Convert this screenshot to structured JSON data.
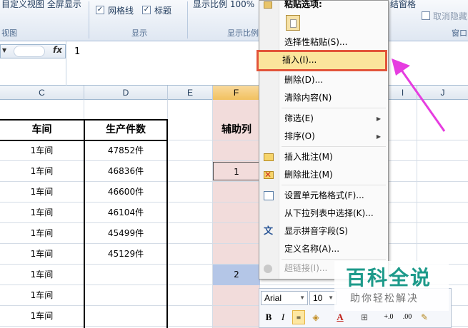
{
  "ribbon": {
    "view_buttons": "目定义视图 全屏显示",
    "checkbox_gridlines": "网格线",
    "checkbox_headings": "标题",
    "group_views": "视图",
    "group_show": "显示",
    "zoom_label": "显示比例 100%",
    "group_zoom": "显示比例",
    "freeze_panes": "结窗格",
    "unhide": "取消隐藏",
    "group_window": "窗口"
  },
  "formula_bar": {
    "fx_label": "fx",
    "value": "1"
  },
  "columns": [
    "C",
    "D",
    "E",
    "F",
    "I",
    "J"
  ],
  "table": {
    "header_workshop": "车间",
    "header_count": "生产件数",
    "helper_header": "辅助列",
    "rows": [
      {
        "workshop": "1车间",
        "count": "47852件"
      },
      {
        "workshop": "1车间",
        "count": "46836件"
      },
      {
        "workshop": "1车间",
        "count": "46600件"
      },
      {
        "workshop": "1车间",
        "count": "46104件"
      },
      {
        "workshop": "1车间",
        "count": "45499件"
      },
      {
        "workshop": "1车间",
        "count": "45129件"
      },
      {
        "workshop": "1车间",
        "count": ""
      },
      {
        "workshop": "1车间",
        "count": ""
      },
      {
        "workshop": "1车间",
        "count": ""
      }
    ],
    "helper_values": [
      "1",
      "2"
    ]
  },
  "context_menu": {
    "paste_options": "粘贴选项:",
    "paste_special": "选择性粘贴(S)...",
    "insert": "插入(I)...",
    "delete": "删除(D)...",
    "clear_contents": "清除内容(N)",
    "filter": "筛选(E)",
    "sort": "排序(O)",
    "insert_comment": "插入批注(M)",
    "delete_comment": "删除批注(M)",
    "format_cells": "设置单元格格式(F)...",
    "pick_from_list": "从下拉列表中选择(K)...",
    "show_phonetic": "显示拼音字段(S)",
    "define_name": "定义名称(A)...",
    "hyperlink": "超链接(I)..."
  },
  "mini_toolbar": {
    "font": "Arial",
    "size": "10",
    "bold": "B",
    "italic": "I"
  },
  "watermark": {
    "title": "百科全说",
    "subtitle": "助你轻松解决"
  },
  "colors": {
    "highlight_border": "#e2543a",
    "arrow": "#e63de0",
    "helper_column": "#f2dcdb",
    "selected_cell": "#b4c6e7",
    "watermark": "#1d9a8a"
  }
}
